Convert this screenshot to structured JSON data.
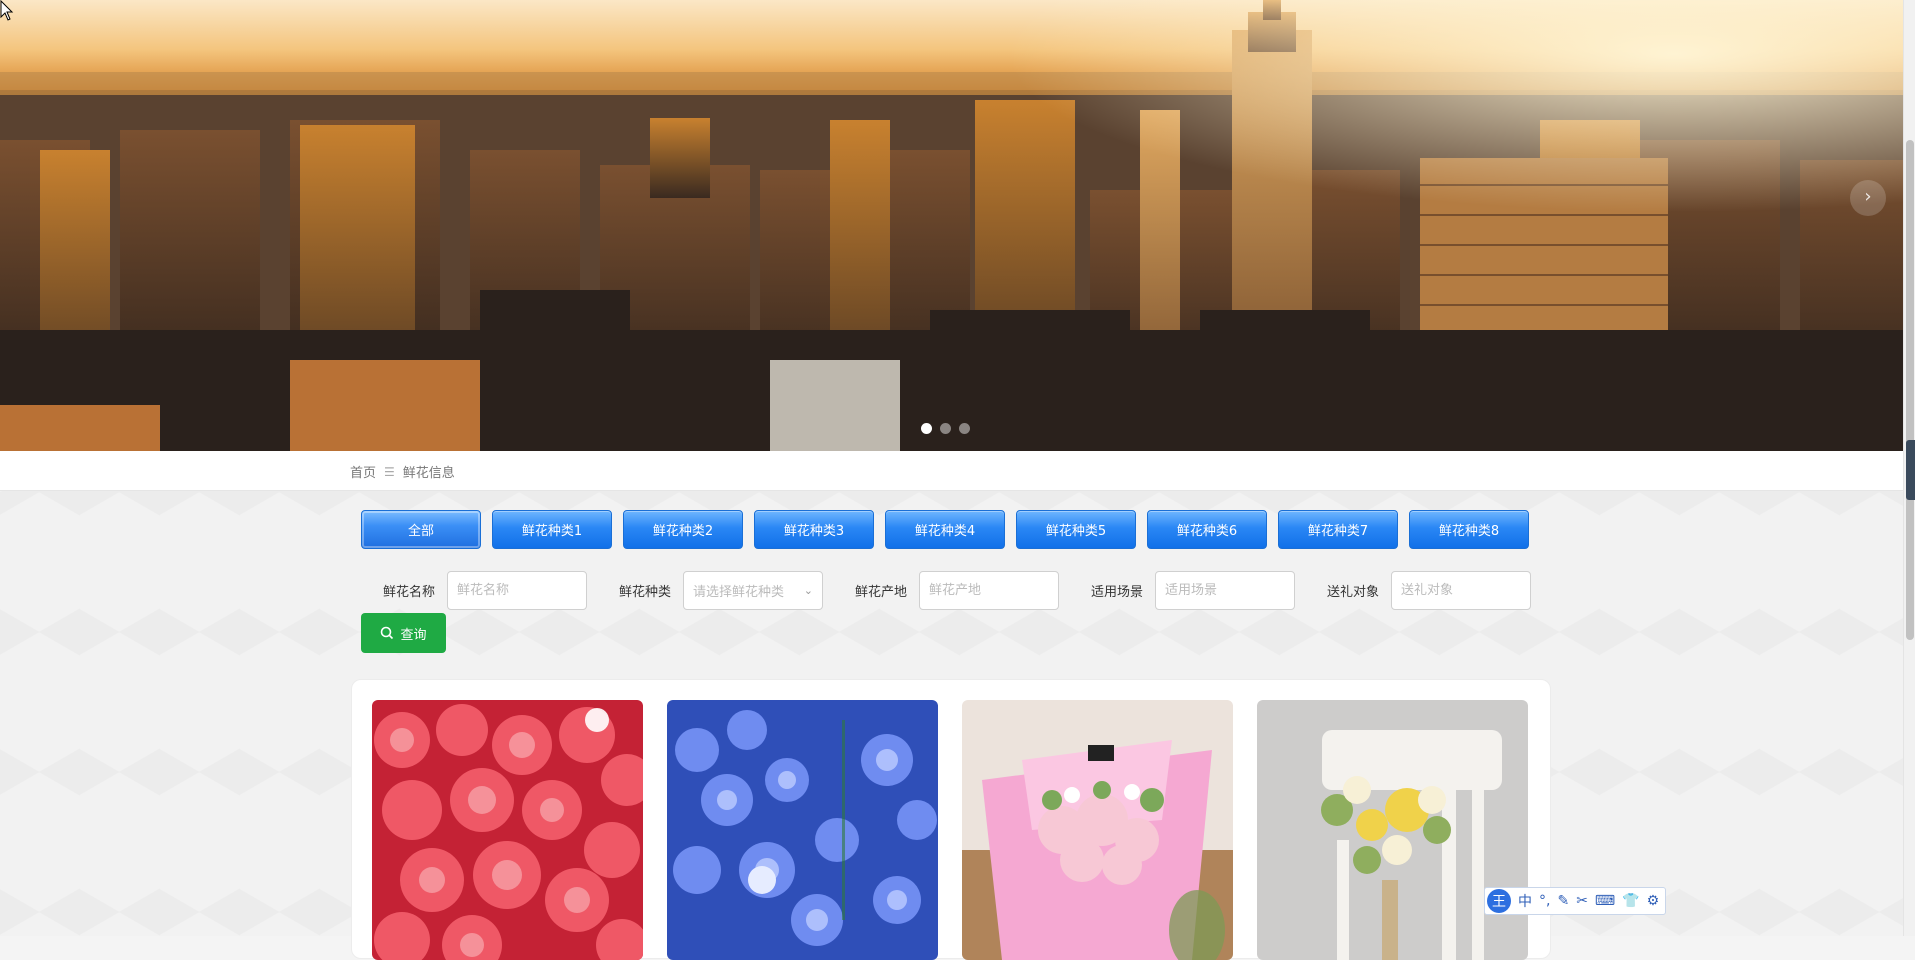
{
  "banner": {
    "next_arrow": "›",
    "slides": [
      1,
      2,
      3
    ],
    "active_slide": 1
  },
  "breadcrumb": {
    "home": "首页",
    "separator": "☰",
    "current": "鲜花信息"
  },
  "categories": [
    {
      "label": "全部",
      "active": true
    },
    {
      "label": "鲜花种类1"
    },
    {
      "label": "鲜花种类2"
    },
    {
      "label": "鲜花种类3"
    },
    {
      "label": "鲜花种类4"
    },
    {
      "label": "鲜花种类5"
    },
    {
      "label": "鲜花种类6"
    },
    {
      "label": "鲜花种类7"
    },
    {
      "label": "鲜花种类8"
    }
  ],
  "search": {
    "name": {
      "label": "鲜花名称",
      "placeholder": "鲜花名称"
    },
    "type": {
      "label": "鲜花种类",
      "placeholder": "请选择鲜花种类"
    },
    "origin": {
      "label": "鲜花产地",
      "placeholder": "鲜花产地"
    },
    "scene": {
      "label": "适用场景",
      "placeholder": "适用场景"
    },
    "target": {
      "label": "送礼对象",
      "placeholder": "送礼对象"
    },
    "button_label": "查询",
    "button_icon": "search-icon"
  },
  "products": [
    {
      "image": "red-roses",
      "color": "#e04050"
    },
    {
      "image": "blue-hydrangea",
      "color": "#5a7de8"
    },
    {
      "image": "pink-bouquet",
      "color": "#f3a6c8"
    },
    {
      "image": "yellow-bouquet-on-chair",
      "color": "#e9c94a"
    }
  ],
  "ime": {
    "logo": "王",
    "tools": [
      "中",
      "°,",
      "✎",
      "✂",
      "⌨",
      "👕",
      "⚙"
    ]
  },
  "colors": {
    "category_blue": "#2a87f5",
    "search_green": "#1faa44"
  }
}
